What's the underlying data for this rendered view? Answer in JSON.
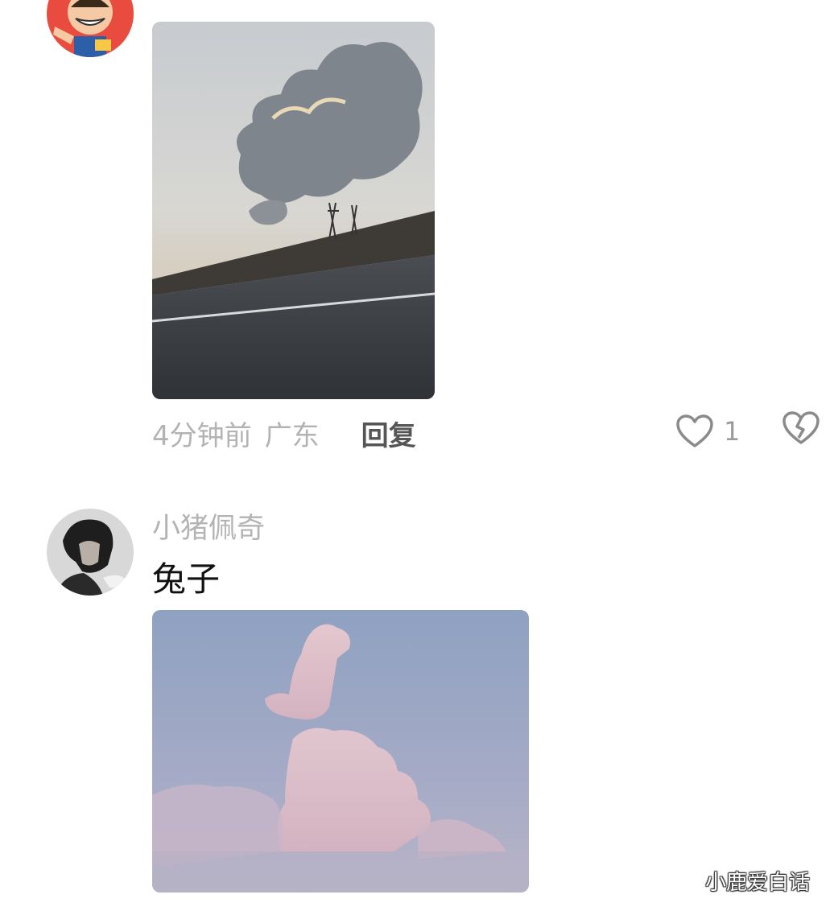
{
  "comment1": {
    "time": "4分钟前",
    "location": "广东",
    "reply_label": "回复",
    "like_count": "1"
  },
  "comment2": {
    "username": "小猪佩奇",
    "text": "兔子"
  },
  "watermark": "小鹿爱白话",
  "colors": {
    "meta_text": "#b3b3b3",
    "reply_text": "#555555",
    "body_text": "#111111"
  },
  "icons": {
    "like": "heart-outline-icon",
    "dislike": "broken-heart-icon"
  }
}
